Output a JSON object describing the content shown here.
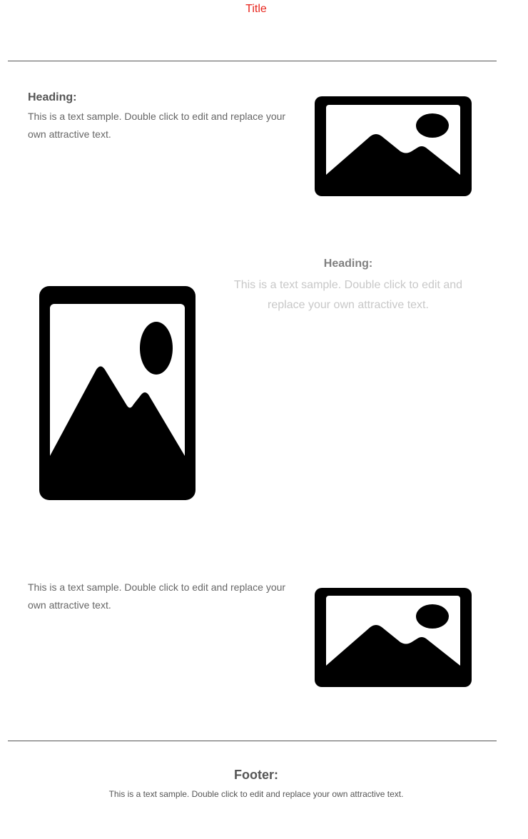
{
  "header": {
    "title": "Title"
  },
  "section1": {
    "heading": "Heading:",
    "text": "This is a text sample. Double click to edit and replace your own attractive text.",
    "image_icon": "image-placeholder-icon"
  },
  "section2": {
    "heading": "Heading:",
    "text": "This is a text sample. Double click to edit and replace your own attractive text.",
    "image_icon": "image-placeholder-icon"
  },
  "section3": {
    "text": "This is a text sample. Double click to edit and replace your own attractive text.",
    "image_icon": "image-placeholder-icon"
  },
  "footer": {
    "heading": "Footer:",
    "text": "This is a text sample. Double click to edit and replace your own attractive text."
  },
  "colors": {
    "title": "#e8241c",
    "rule": "#555555",
    "heading": "#555555",
    "body_text": "#666666",
    "faded_heading": "#808080",
    "faded_text": "#c8c8c8"
  }
}
